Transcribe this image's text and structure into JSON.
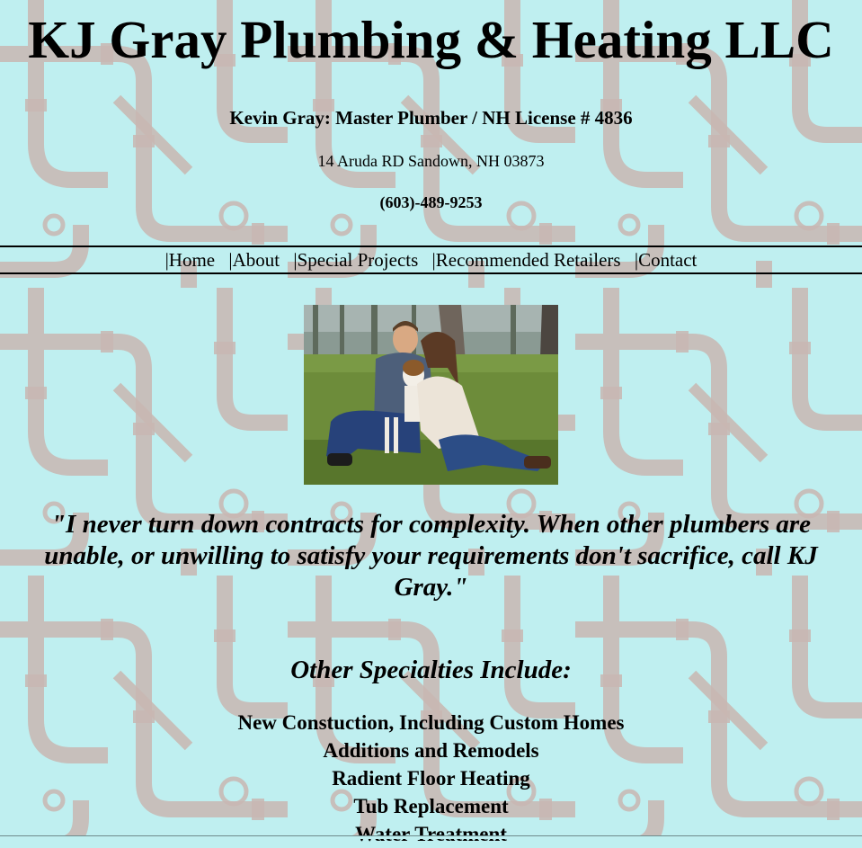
{
  "header": {
    "title": "KJ Gray Plumbing & Heating LLC",
    "owner": "Kevin Gray: Master Plumber / NH License # 4836",
    "address": "14 Aruda RD Sandown, NH 03873",
    "phone": "(603)-489-9253"
  },
  "nav": {
    "items": [
      {
        "separator": "|",
        "label": "Home"
      },
      {
        "separator": "|",
        "label": "About"
      },
      {
        "separator": "|",
        "label": "Special Projects"
      },
      {
        "separator": "|",
        "label": "Recommended Retailers"
      },
      {
        "separator": "|",
        "label": "Contact"
      }
    ]
  },
  "photo": {
    "icon": "family-photo"
  },
  "quote": "\"I never turn down contracts for complexity. When other plumbers are unable, or unwilling to satisfy your requirements don't sacrifice, call KJ Gray.\"",
  "specialties": {
    "heading": "Other Specialties Include:",
    "items": [
      "New Constuction, Including Custom Homes",
      "Additions and Remodels",
      "Radient Floor Heating",
      "Tub Replacement",
      "Water Treatment"
    ]
  },
  "colors": {
    "background": "#bfeff0",
    "pipe": "#c9b6b1",
    "text": "#000000"
  }
}
